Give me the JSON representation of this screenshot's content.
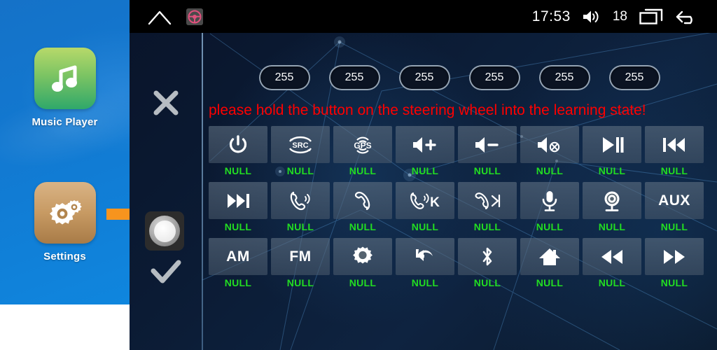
{
  "sidebar": {
    "apps": [
      {
        "label": "Music Player",
        "icon": "music-note-icon"
      },
      {
        "label": "Settings",
        "icon": "gears-icon"
      }
    ],
    "pointer": "orange-arrow-icon"
  },
  "statusbar": {
    "home_icon": "home-icon",
    "steering_icon": "steering-wheel-icon",
    "time": "17:53",
    "volume_icon": "volume-icon",
    "volume_level": "18",
    "recents_icon": "recent-apps-icon",
    "back_icon": "back-arrow-icon"
  },
  "controls": {
    "cancel_icon": "close-x-icon",
    "knob_icon": "rotary-knob-icon",
    "confirm_icon": "checkmark-icon"
  },
  "values": [
    "255",
    "255",
    "255",
    "255",
    "255",
    "255"
  ],
  "warning": "please hold the button on the steering wheel into the learning state!",
  "grid": {
    "rows": [
      [
        {
          "icon": "power-icon",
          "text": "",
          "label": "NULL"
        },
        {
          "icon": "src-icon",
          "text": "",
          "label": "NULL"
        },
        {
          "icon": "gps-icon",
          "text": "",
          "label": "NULL"
        },
        {
          "icon": "volume-up-icon",
          "text": "",
          "label": "NULL"
        },
        {
          "icon": "volume-down-icon",
          "text": "",
          "label": "NULL"
        },
        {
          "icon": "volume-mute-icon",
          "text": "",
          "label": "NULL"
        },
        {
          "icon": "play-pause-icon",
          "text": "",
          "label": "NULL"
        },
        {
          "icon": "previous-track-icon",
          "text": "",
          "label": "NULL"
        }
      ],
      [
        {
          "icon": "next-track-icon",
          "text": "",
          "label": "NULL"
        },
        {
          "icon": "answer-call-icon",
          "text": "",
          "label": "NULL"
        },
        {
          "icon": "hangup-call-icon",
          "text": "",
          "label": "NULL"
        },
        {
          "icon": "call-k-icon",
          "text": "",
          "label": "NULL"
        },
        {
          "icon": "hangup-skip-icon",
          "text": "",
          "label": "NULL"
        },
        {
          "icon": "microphone-icon",
          "text": "",
          "label": "NULL"
        },
        {
          "icon": "camera-icon",
          "text": "",
          "label": "NULL"
        },
        {
          "icon": "aux-label-icon",
          "text": "AUX",
          "label": "NULL"
        }
      ],
      [
        {
          "icon": "am-label-icon",
          "text": "AM",
          "label": "NULL"
        },
        {
          "icon": "fm-label-icon",
          "text": "FM",
          "label": "NULL"
        },
        {
          "icon": "gear-icon",
          "text": "",
          "label": "NULL"
        },
        {
          "icon": "undo-arrow-icon",
          "text": "",
          "label": "NULL"
        },
        {
          "icon": "bluetooth-icon",
          "text": "",
          "label": "NULL"
        },
        {
          "icon": "home-house-icon",
          "text": "",
          "label": "NULL"
        },
        {
          "icon": "rewind-icon",
          "text": "",
          "label": "NULL"
        },
        {
          "icon": "fast-forward-icon",
          "text": "",
          "label": "NULL"
        }
      ]
    ]
  },
  "colors": {
    "warning_text": "#ff0000",
    "label_text": "#22dd22",
    "sidebar_blue": "#1278d0",
    "accent_orange": "#f7941e"
  }
}
